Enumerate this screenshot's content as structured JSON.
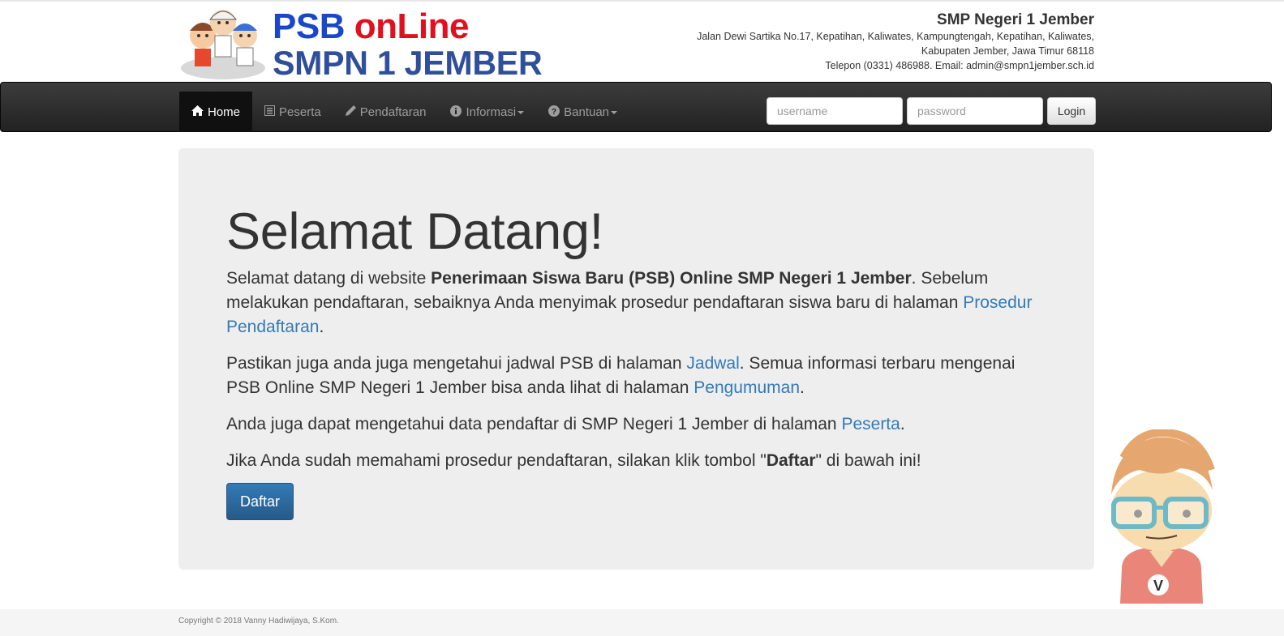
{
  "header": {
    "logo": {
      "line1_a": "PSB",
      "line1_b": "onLine",
      "line2": "SMPN 1 JEMBER",
      "icon": "children-mascot-logo"
    },
    "school_name": "SMP Negeri 1 Jember",
    "address_1": "Jalan Dewi Sartika No.17, Kepatihan, Kaliwates, Kampungtengah, Kepatihan, Kaliwates,",
    "address_2": "Kabupaten Jember, Jawa Timur 68118",
    "contact": "Telepon (0331) 486988. Email: admin@smpn1jember.sch.id"
  },
  "nav": {
    "items": [
      {
        "label": "Home",
        "icon": "home-icon"
      },
      {
        "label": "Peserta",
        "icon": "list-icon"
      },
      {
        "label": "Pendaftaran",
        "icon": "pencil-icon"
      },
      {
        "label": "Informasi",
        "icon": "info-icon"
      },
      {
        "label": "Bantuan",
        "icon": "question-icon"
      }
    ],
    "username_placeholder": "username",
    "password_placeholder": "password",
    "login_label": "Login"
  },
  "main": {
    "title": "Selamat Datang!",
    "p1_a": "Selamat datang di website ",
    "p1_bold": "Penerimaan Siswa Baru (PSB) Online SMP Negeri 1 Jember",
    "p1_b": ". Sebelum melakukan pendaftaran, sebaiknya Anda menyimak prosedur pendaftaran siswa baru di halaman ",
    "p1_link": "Prosedur Pendaftaran",
    "p1_c": ".",
    "p2_a": "Pastikan juga anda juga mengetahui jadwal PSB di halaman ",
    "p2_link1": "Jadwal",
    "p2_b": ". Semua informasi terbaru mengenai PSB Online SMP Negeri 1 Jember bisa anda lihat di halaman ",
    "p2_link2": "Pengumuman",
    "p2_c": ".",
    "p3_a": "Anda juga dapat mengetahui data pendaftar di SMP Negeri 1 Jember di halaman ",
    "p3_link": "Peserta",
    "p3_b": ".",
    "p4_a": "Jika Anda sudah memahami prosedur pendaftaran, silakan klik tombol \"",
    "p4_bold": "Daftar",
    "p4_b": "\" di bawah ini!",
    "button": "Daftar"
  },
  "footer": {
    "copyright": "Copyright © 2018 Vanny Hadiwijaya, S.Kom."
  },
  "colors": {
    "brand_blue": "#1a47c9",
    "brand_red": "#e0101e",
    "link": "#337ab7",
    "navbar": "#222222"
  }
}
